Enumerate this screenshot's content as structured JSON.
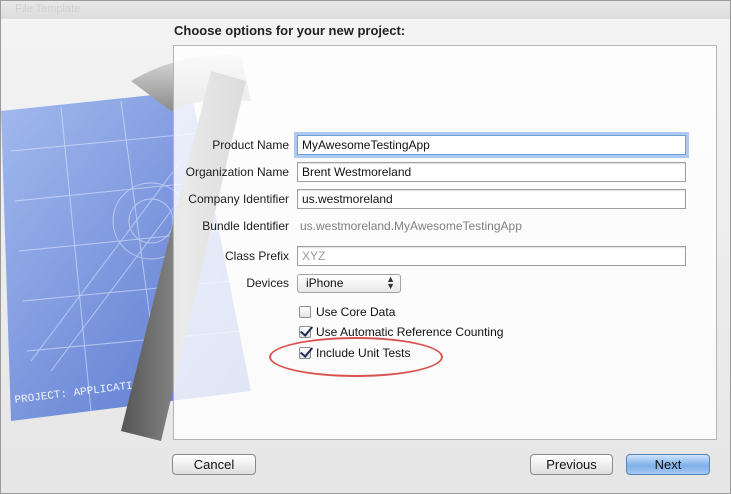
{
  "window": {
    "ghost_title": "File Template"
  },
  "heading": "Choose options for your new project:",
  "fields": {
    "product_name": {
      "label": "Product Name",
      "value": "MyAwesomeTestingApp"
    },
    "organization_name": {
      "label": "Organization Name",
      "value": "Brent Westmoreland"
    },
    "company_identifier": {
      "label": "Company Identifier",
      "value": "us.westmoreland"
    },
    "bundle_identifier": {
      "label": "Bundle Identifier",
      "value": "us.westmoreland.MyAwesomeTestingApp"
    },
    "class_prefix": {
      "label": "Class Prefix",
      "placeholder": "XYZ"
    },
    "devices": {
      "label": "Devices",
      "value": "iPhone"
    }
  },
  "checkboxes": {
    "core_data": {
      "label": "Use Core Data",
      "checked": false
    },
    "arc": {
      "label": "Use Automatic Reference Counting",
      "checked": true
    },
    "unit_tests": {
      "label": "Include Unit Tests",
      "checked": true
    }
  },
  "buttons": {
    "cancel": "Cancel",
    "previous": "Previous",
    "next": "Next"
  },
  "art": {
    "blueprint_text": "PROJECT: APPLICATION.APP"
  },
  "colors": {
    "annotation": "#d9534f",
    "accent": "#7fb0ea",
    "blueprint": "#5d7fd6"
  }
}
